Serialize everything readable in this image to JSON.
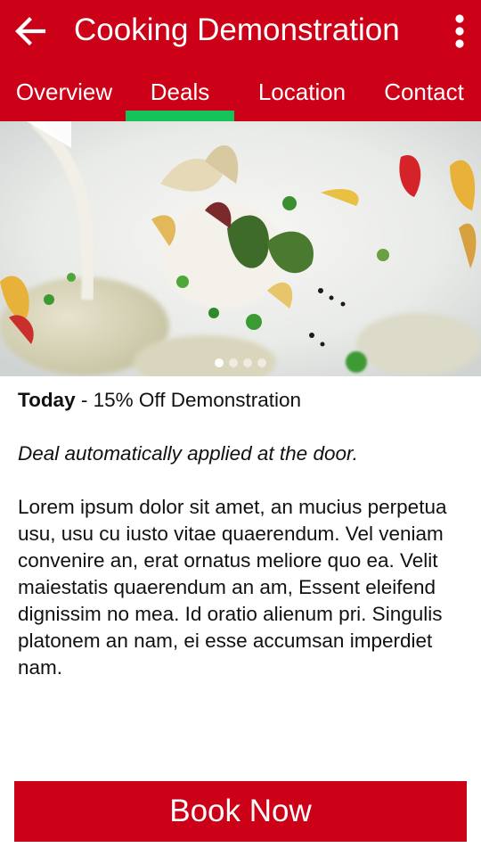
{
  "header": {
    "title": "Cooking Demonstration",
    "back_icon": "arrow-left-icon",
    "menu_icon": "more-vertical-icon",
    "background_color": "#cc0016"
  },
  "tabs": [
    {
      "label": "Overview",
      "selected": false
    },
    {
      "label": "Deals",
      "selected": true
    },
    {
      "label": "Location",
      "selected": false
    },
    {
      "label": "Contact",
      "selected": false
    }
  ],
  "tab_indicator_color": "#16c25a",
  "carousel": {
    "image": "plated gourmet dish",
    "slide_count": 4,
    "active_index": 0
  },
  "deal": {
    "day": "Today",
    "separator": " - ",
    "offer": "15% Off Demonstration",
    "note": "Deal automatically applied at the door.",
    "description": "Lorem ipsum dolor sit amet, an mucius perpetua usu, usu cu iusto vitae quaerendum. Vel veniam convenire an, erat ornatus meliore quo ea. Velit maiestatis quaerendum an am, Essent eleifend dignissim no mea. Id oratio alienum pri. Singulis platonem an nam, ei esse accumsan imperdiet nam."
  },
  "book_button": {
    "label": "Book Now"
  }
}
